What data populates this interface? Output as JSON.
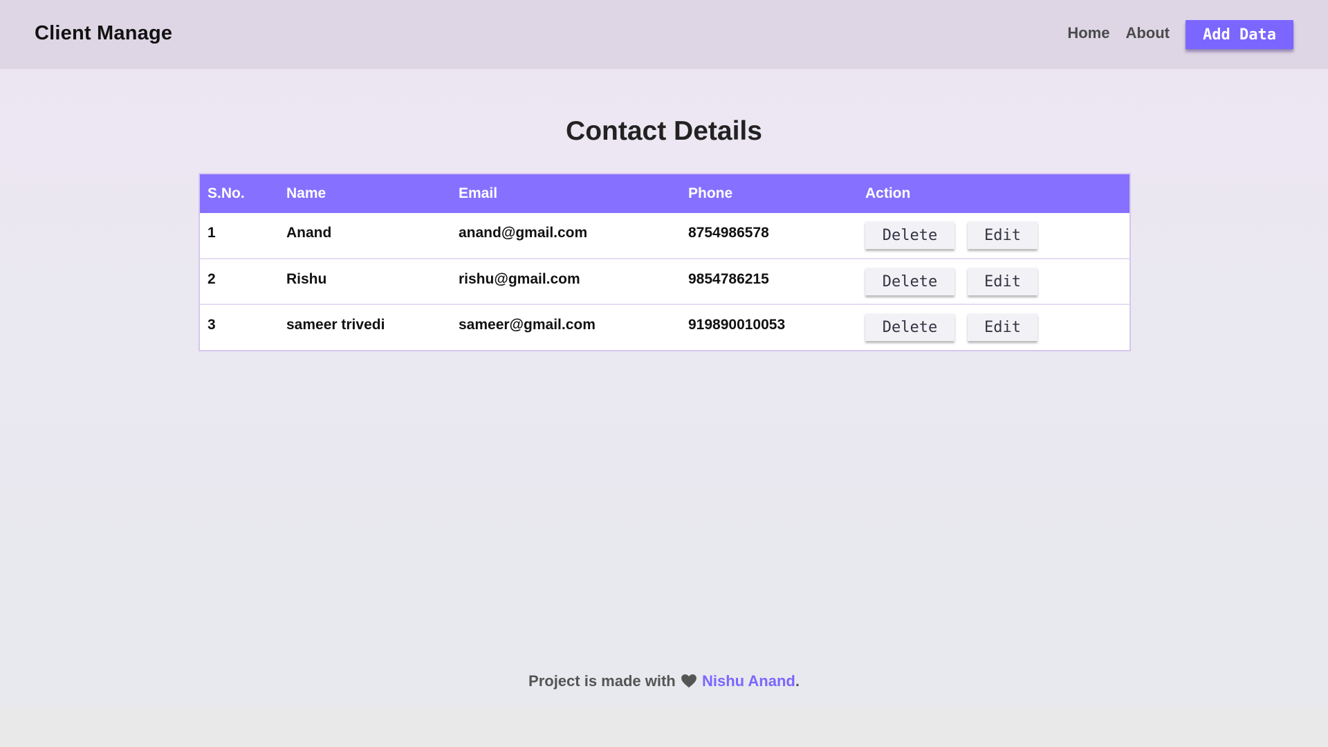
{
  "navbar": {
    "brand": "Client Manage",
    "links": [
      "Home",
      "About"
    ],
    "add_button": "Add Data"
  },
  "page_title": "Contact Details",
  "table": {
    "headers": [
      "S.No.",
      "Name",
      "Email",
      "Phone",
      "Action"
    ],
    "rows": [
      {
        "sno": "1",
        "name": "Anand",
        "email": "anand@gmail.com",
        "phone": "8754986578"
      },
      {
        "sno": "2",
        "name": "Rishu",
        "email": "rishu@gmail.com",
        "phone": "9854786215"
      },
      {
        "sno": "3",
        "name": "sameer trivedi",
        "email": "sameer@gmail.com",
        "phone": "919890010053"
      }
    ],
    "delete_label": "Delete",
    "edit_label": "Edit"
  },
  "footer": {
    "prefix": "Project is made with",
    "heart_icon": "heart-icon",
    "author": "Nishu Anand",
    "suffix": "."
  },
  "colors": {
    "accent": "#7b66ff",
    "header_bg": "#8670ff",
    "navbar_bg": "#ded6e4"
  }
}
